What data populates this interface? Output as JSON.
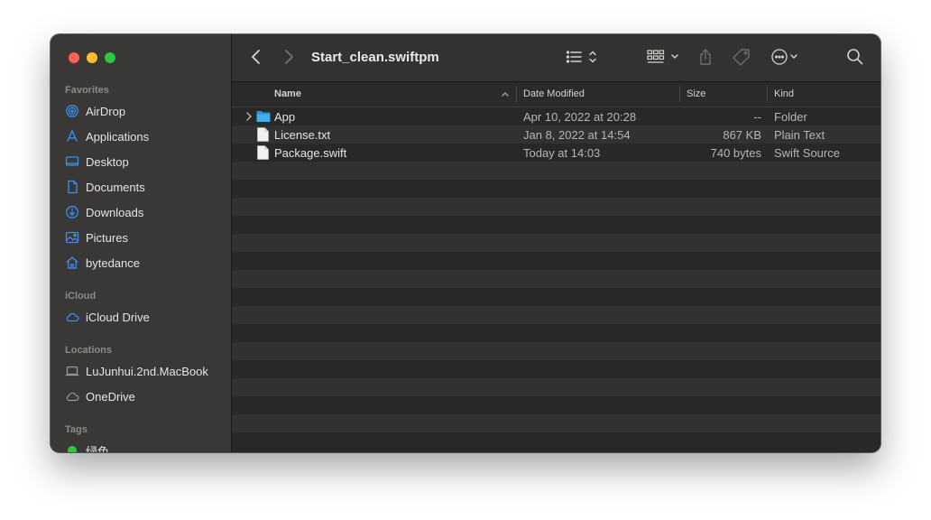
{
  "window": {
    "title": "Start_clean.swiftpm"
  },
  "sidebar": {
    "sections": {
      "favorites": "Favorites",
      "icloud": "iCloud",
      "locations": "Locations",
      "tags": "Tags"
    },
    "favorites": [
      {
        "label": "AirDrop",
        "icon": "airdrop-icon"
      },
      {
        "label": "Applications",
        "icon": "applications-icon"
      },
      {
        "label": "Desktop",
        "icon": "desktop-icon"
      },
      {
        "label": "Documents",
        "icon": "document-icon"
      },
      {
        "label": "Downloads",
        "icon": "download-icon"
      },
      {
        "label": "Pictures",
        "icon": "pictures-icon"
      },
      {
        "label": "bytedance",
        "icon": "home-icon"
      }
    ],
    "icloud": [
      {
        "label": "iCloud Drive",
        "icon": "cloud-icon"
      }
    ],
    "locations": [
      {
        "label": "LuJunhui.2nd.MacBook",
        "icon": "laptop-icon"
      },
      {
        "label": "OneDrive",
        "icon": "cloud-icon"
      }
    ],
    "tags": [
      {
        "label": "绿色",
        "color": "#28c840"
      }
    ]
  },
  "toolbar": {
    "back_icon": "chevron-left-icon",
    "forward_icon": "chevron-right-icon",
    "view_icon": "list-view-icon",
    "group_icon": "grid-icon",
    "share_icon": "share-icon",
    "tag_icon": "tag-icon",
    "more_icon": "ellipsis-circle-icon",
    "search_icon": "search-icon"
  },
  "columns": {
    "name": "Name",
    "date": "Date Modified",
    "size": "Size",
    "kind": "Kind"
  },
  "files": [
    {
      "name": "App",
      "date": "Apr 10, 2022 at 20:28",
      "size": "--",
      "kind": "Folder",
      "icon": "folder-icon"
    },
    {
      "name": "License.txt",
      "date": "Jan 8, 2022 at 14:54",
      "size": "867 KB",
      "kind": "Plain Text",
      "icon": "file-icon"
    },
    {
      "name": "Package.swift",
      "date": "Today at 14:03",
      "size": "740 bytes",
      "kind": "Swift Source",
      "icon": "file-icon"
    }
  ],
  "colors": {
    "sidebar_icon": "#3b8ef0",
    "folder": "#37a7e6"
  }
}
